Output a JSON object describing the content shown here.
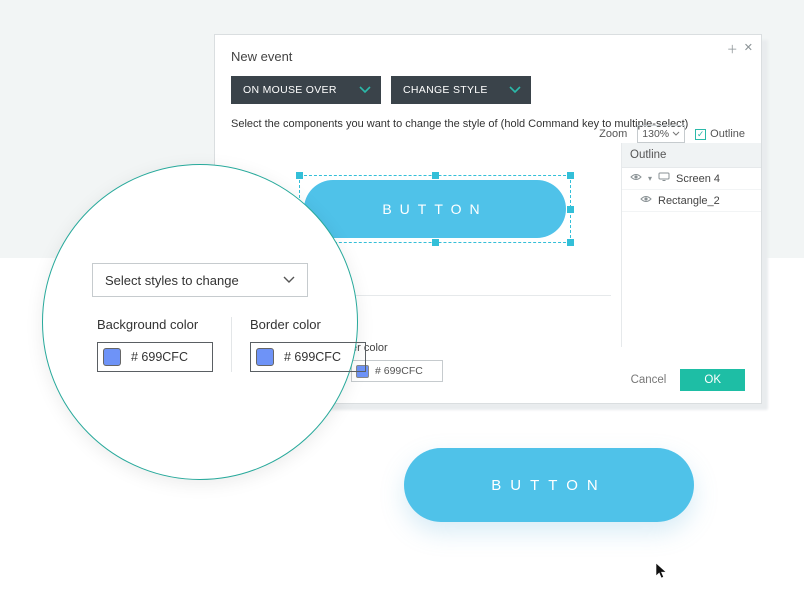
{
  "dialog": {
    "title": "New event",
    "triggers": {
      "trigger_label": "ON MOUSE OVER",
      "action_label": "CHANGE STYLE"
    },
    "instruction": "Select the components you want to change the style of (hold Command key to multiple-select)",
    "zoom": {
      "label": "Zoom",
      "value": "130%"
    },
    "outline_toggle": {
      "label": "Outline",
      "checked": true
    },
    "outline_panel": {
      "header": "Outline",
      "layers": [
        {
          "name": "Screen 4",
          "is_screen": true
        },
        {
          "name": "Rectangle_2",
          "is_screen": false
        }
      ]
    },
    "canvas_button_text": "BUTTON",
    "style_section": {
      "border_color_label": "er color",
      "border_color_value": "# 699CFC"
    },
    "footer": {
      "cancel": "Cancel",
      "ok": "OK"
    }
  },
  "zoom_circle": {
    "select_placeholder": "Select styles to change",
    "bg": {
      "label": "Background color",
      "value": "# 699CFC",
      "swatch": "#6E93F7"
    },
    "border": {
      "label": "Border color",
      "value": "# 699CFC",
      "swatch": "#6E93F7"
    }
  },
  "lower_button_text": "BUTTON"
}
